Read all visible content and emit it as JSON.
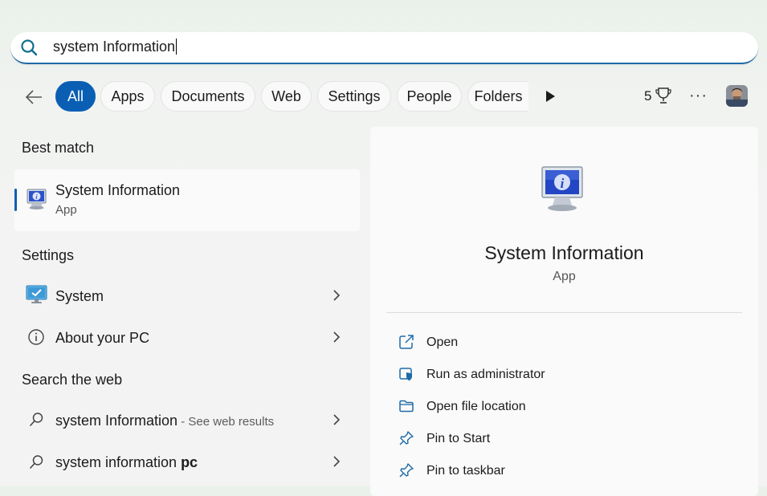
{
  "search": {
    "query": "system Information"
  },
  "filters": [
    {
      "label": "All",
      "active": true
    },
    {
      "label": "Apps"
    },
    {
      "label": "Documents"
    },
    {
      "label": "Web"
    },
    {
      "label": "Settings"
    },
    {
      "label": "People"
    },
    {
      "label": "Folders"
    }
  ],
  "rewards": {
    "count": "5"
  },
  "best_match": {
    "heading": "Best match",
    "title": "System Information",
    "subtitle": "App"
  },
  "settings_section": {
    "heading": "Settings",
    "items": [
      {
        "label": "System"
      },
      {
        "label": "About your PC"
      }
    ]
  },
  "web_section": {
    "heading": "Search the web",
    "items": [
      {
        "label": "system Information",
        "suffix": " - See web results"
      },
      {
        "label_prefix": "system information ",
        "label_bold": "pc"
      }
    ]
  },
  "detail": {
    "title": "System Information",
    "subtitle": "App",
    "actions": [
      {
        "label": "Open",
        "icon": "open-external-icon"
      },
      {
        "label": "Run as administrator",
        "icon": "shield-admin-icon"
      },
      {
        "label": "Open file location",
        "icon": "folder-icon"
      },
      {
        "label": "Pin to Start",
        "icon": "pin-icon"
      },
      {
        "label": "Pin to taskbar",
        "icon": "pin-icon"
      }
    ]
  },
  "colors": {
    "accent": "#0a5fb4",
    "search_underline": "#1e6aa8"
  }
}
